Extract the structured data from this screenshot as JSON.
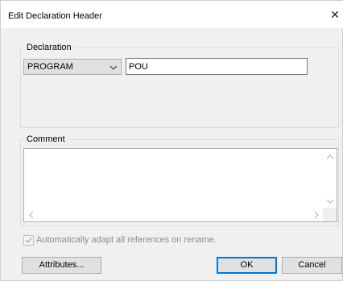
{
  "window": {
    "title": "Edit Declaration Header",
    "close_glyph": "✕"
  },
  "declaration": {
    "legend": "Declaration",
    "type_value": "PROGRAM",
    "name_value": "POU"
  },
  "comment": {
    "legend": "Comment",
    "value": ""
  },
  "options": {
    "auto_adapt_label": "Automatically adapt all references on rename.",
    "auto_adapt_checked": true,
    "auto_adapt_enabled": false
  },
  "buttons": {
    "attributes_label": "Attributes...",
    "ok_label": "OK",
    "cancel_label": "Cancel"
  },
  "colors": {
    "dialog_bg": "#f0f0f0",
    "default_button_border": "#0078d7"
  }
}
